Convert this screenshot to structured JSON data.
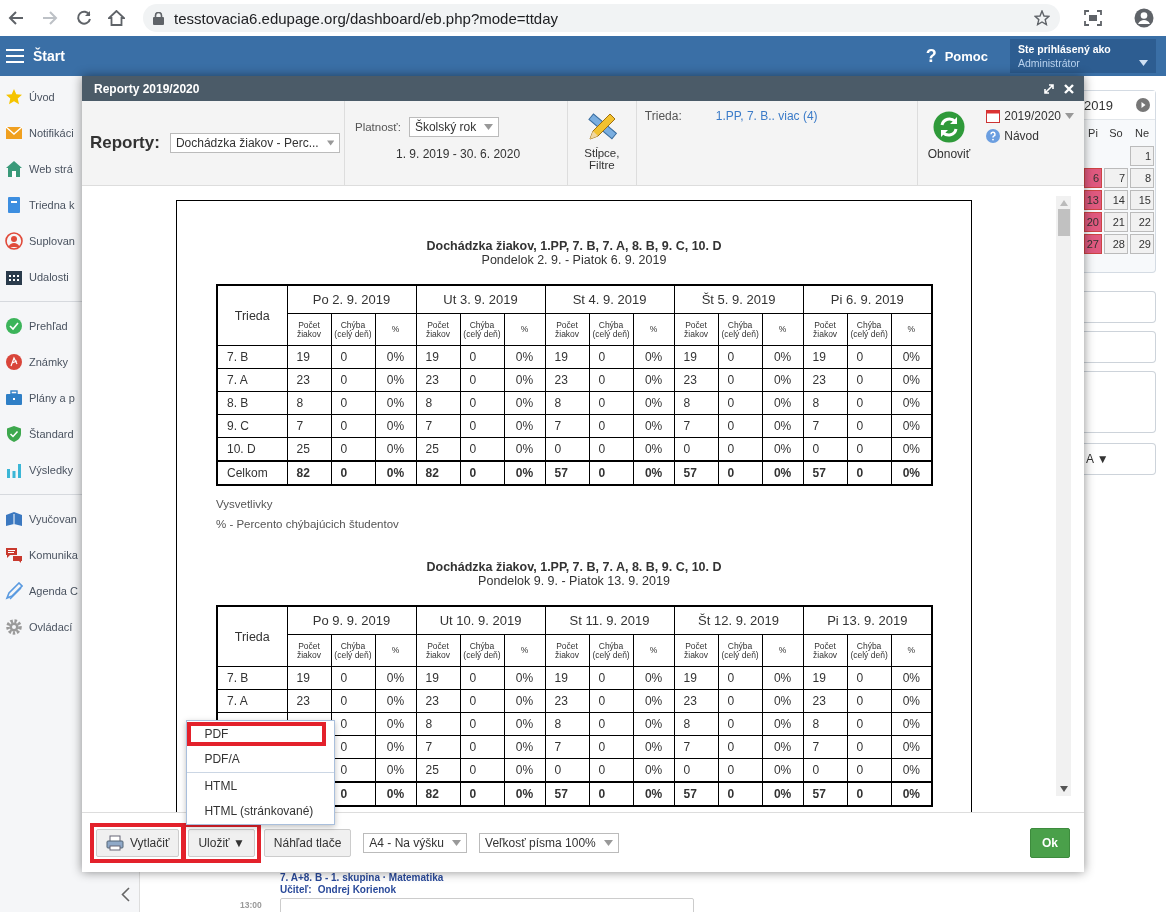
{
  "browser": {
    "url": "tesstovacia6.edupage.org/dashboard/eb.php?mode=ttday"
  },
  "header": {
    "menu_label": "Štart",
    "help_icon": "?",
    "help_label": "Pomoc",
    "user_caption": "Ste prihlásený ako",
    "user_name": "Administrátor"
  },
  "sidebar": {
    "groups": [
      [
        {
          "label": "Úvod",
          "kind": "star"
        },
        {
          "label": "Notifikáci",
          "kind": "mail"
        },
        {
          "label": "Web strá",
          "kind": "home"
        },
        {
          "label": "Triedna k",
          "kind": "notebook"
        },
        {
          "label": "Suplovan",
          "kind": "person"
        },
        {
          "label": "Udalosti",
          "kind": "calendar"
        }
      ],
      [
        {
          "label": "Prehľad",
          "kind": "check"
        },
        {
          "label": "Známky",
          "kind": "grade"
        },
        {
          "label": "Plány a p",
          "kind": "briefcase"
        },
        {
          "label": "Štandard",
          "kind": "shield"
        },
        {
          "label": "Výsledky",
          "kind": "chart"
        }
      ],
      [
        {
          "label": "Vyučovan",
          "kind": "book"
        },
        {
          "label": "Komunika",
          "kind": "chat"
        },
        {
          "label": "Agenda C",
          "kind": "pencil"
        },
        {
          "label": "Ovládací",
          "kind": "gear"
        }
      ]
    ]
  },
  "calendar": {
    "title": "2019",
    "weekdays": [
      "Pi",
      "So",
      "Ne"
    ],
    "weeks": [
      [
        {
          "day": "1",
          "marked": false
        }
      ],
      [
        {
          "day": "6",
          "marked": true
        },
        {
          "day": "7",
          "marked": false
        },
        {
          "day": "8",
          "marked": false
        }
      ],
      [
        {
          "day": "13",
          "marked": true
        },
        {
          "day": "14",
          "marked": false
        },
        {
          "day": "15",
          "marked": false
        }
      ],
      [
        {
          "day": "20",
          "marked": true
        },
        {
          "day": "21",
          "marked": false
        },
        {
          "day": "22",
          "marked": false
        }
      ],
      [
        {
          "day": "27",
          "marked": true
        },
        {
          "day": "28",
          "marked": false
        },
        {
          "day": "29",
          "marked": false
        }
      ]
    ],
    "filter_value": "A ▼"
  },
  "schedule": {
    "lesson_title": "7. A+8. B - 1. skupina · Matematika",
    "teacher_label": "Učiteľ:",
    "teacher_name": "Ondrej Korienok",
    "time": "13:00"
  },
  "dialog": {
    "title": "Reporty 2019/2020",
    "toolbar": {
      "report_label": "Reporty:",
      "report_value": "Dochádzka žiakov - Perc...",
      "validity_label": "Platnosť:",
      "validity_value": "Školský rok",
      "date_range": "1. 9. 2019 - 30. 6. 2020",
      "columns_label": "Stĺpce, Filtre",
      "class_label": "Trieda:",
      "class_value": "1.PP, 7. B.. viac (4)",
      "refresh_label": "Obnoviť",
      "year_label": "2019/2020",
      "help_label": "Návod"
    },
    "report": {
      "sections": [
        {
          "title": "Dochádzka žiakov, 1.PP, 7. B, 7. A, 8. B, 9. C, 10. D",
          "subtitle": "Pondelok 2. 9. - Piatok 6. 9. 2019",
          "class_header": "Trieda",
          "days": [
            {
              "label": "Po 2. 9. 2019",
              "columns": [
                "Počet žiakov",
                "Chýba (celý deň)",
                "%"
              ]
            },
            {
              "label": "Ut 3. 9. 2019",
              "columns": [
                "Počet žiakov",
                "Chýba (celý deň)",
                "%"
              ]
            },
            {
              "label": "St 4. 9. 2019",
              "columns": [
                "Počet žiakov",
                "Chýba (celý deň)",
                "%"
              ]
            },
            {
              "label": "Št 5. 9. 2019",
              "columns": [
                "Počet žiakov",
                "Chýba (celý deň)",
                "%"
              ]
            },
            {
              "label": "Pi 6. 9. 2019",
              "columns": [
                "Počet žiakov",
                "Chýba (celý deň)",
                "%"
              ]
            }
          ],
          "rows": [
            {
              "kind": "class",
              "name": "7. B",
              "cells": [
                "19",
                "0",
                "0%",
                "19",
                "0",
                "0%",
                "19",
                "0",
                "0%",
                "19",
                "0",
                "0%",
                "19",
                "0",
                "0%"
              ]
            },
            {
              "kind": "class",
              "name": "7. A",
              "cells": [
                "23",
                "0",
                "0%",
                "23",
                "0",
                "0%",
                "23",
                "0",
                "0%",
                "23",
                "0",
                "0%",
                "23",
                "0",
                "0%"
              ]
            },
            {
              "kind": "class",
              "name": "8. B",
              "cells": [
                "8",
                "0",
                "0%",
                "8",
                "0",
                "0%",
                "8",
                "0",
                "0%",
                "8",
                "0",
                "0%",
                "8",
                "0",
                "0%"
              ]
            },
            {
              "kind": "class",
              "name": "9. C",
              "cells": [
                "7",
                "0",
                "0%",
                "7",
                "0",
                "0%",
                "7",
                "0",
                "0%",
                "7",
                "0",
                "0%",
                "7",
                "0",
                "0%"
              ]
            },
            {
              "kind": "class",
              "name": "10. D",
              "cells": [
                "25",
                "0",
                "0%",
                "25",
                "0",
                "0%",
                "0",
                "0",
                "0%",
                "0",
                "0",
                "0%",
                "0",
                "0",
                "0%"
              ]
            },
            {
              "kind": "total",
              "name": "Celkom",
              "cells": [
                "82",
                "0",
                "0%",
                "82",
                "0",
                "0%",
                "57",
                "0",
                "0%",
                "57",
                "0",
                "0%",
                "57",
                "0",
                "0%"
              ]
            }
          ],
          "legend": {
            "title": "Vysvetlivky",
            "text": "% - Percento chýbajúcich študentov"
          }
        },
        {
          "title": "Dochádzka žiakov, 1.PP, 7. B, 7. A, 8. B, 9. C, 10. D",
          "subtitle": "Pondelok 9. 9. - Piatok 13. 9. 2019",
          "class_header": "Trieda",
          "days": [
            {
              "label": "Po 9. 9. 2019",
              "columns": [
                "Počet žiakov",
                "Chýba (celý deň)",
                "%"
              ]
            },
            {
              "label": "Ut 10. 9. 2019",
              "columns": [
                "Počet žiakov",
                "Chýba (celý deň)",
                "%"
              ]
            },
            {
              "label": "St 11. 9. 2019",
              "columns": [
                "Počet žiakov",
                "Chýba (celý deň)",
                "%"
              ]
            },
            {
              "label": "Št 12. 9. 2019",
              "columns": [
                "Počet žiakov",
                "Chýba (celý deň)",
                "%"
              ]
            },
            {
              "label": "Pi 13. 9. 2019",
              "columns": [
                "Počet žiakov",
                "Chýba (celý deň)",
                "%"
              ]
            }
          ],
          "rows": [
            {
              "kind": "class",
              "name": "7. B",
              "cells": [
                "19",
                "0",
                "0%",
                "19",
                "0",
                "0%",
                "19",
                "0",
                "0%",
                "19",
                "0",
                "0%",
                "19",
                "0",
                "0%"
              ]
            },
            {
              "kind": "class",
              "name": "7. A",
              "cells": [
                "23",
                "0",
                "0%",
                "23",
                "0",
                "0%",
                "23",
                "0",
                "0%",
                "23",
                "0",
                "0%",
                "23",
                "0",
                "0%"
              ]
            },
            {
              "kind": "class",
              "name": null,
              "cells": [
                null,
                "0",
                "0%",
                "8",
                "0",
                "0%",
                "8",
                "0",
                "0%",
                "8",
                "0",
                "0%",
                "8",
                "0",
                "0%"
              ]
            },
            {
              "kind": "class",
              "name": null,
              "cells": [
                null,
                "0",
                "0%",
                "7",
                "0",
                "0%",
                "7",
                "0",
                "0%",
                "7",
                "0",
                "0%",
                "7",
                "0",
                "0%"
              ]
            },
            {
              "kind": "class",
              "name": null,
              "cells": [
                null,
                "0",
                "0%",
                "25",
                "0",
                "0%",
                "0",
                "0",
                "0%",
                "0",
                "0",
                "0%",
                "0",
                "0",
                "0%"
              ]
            },
            {
              "kind": "total",
              "name": null,
              "cells": [
                null,
                "0",
                "0%",
                "82",
                "0",
                "0%",
                "57",
                "0",
                "0%",
                "57",
                "0",
                "0%",
                "57",
                "0",
                "0%"
              ]
            }
          ]
        }
      ]
    },
    "footer": {
      "buttons": [
        {
          "label": "Vytlačiť",
          "kind": "print",
          "highlighted": true
        },
        {
          "label": "Uložiť ▼",
          "kind": "menu",
          "highlighted": true
        },
        {
          "label": "Náhľad tlače",
          "kind": "plain",
          "highlighted": false
        }
      ],
      "selects": [
        "A4 - Na výšku",
        "Veľkosť písma 100%"
      ],
      "ok_label": "Ok",
      "save_menu": {
        "groups": [
          [
            {
              "label": "PDF",
              "highlighted": true
            },
            {
              "label": "PDF/A",
              "highlighted": false
            }
          ],
          [
            {
              "label": "HTML",
              "highlighted": false
            },
            {
              "label": "HTML (stránkované)",
              "highlighted": false
            }
          ]
        ]
      }
    }
  }
}
